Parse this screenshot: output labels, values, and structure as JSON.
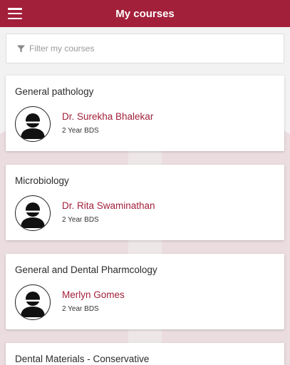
{
  "appbar": {
    "title": "My courses",
    "menu_icon": "hamburger-menu-icon",
    "color": "#a3203b"
  },
  "filter": {
    "placeholder": "Filter my courses",
    "value": "",
    "icon": "filter-icon"
  },
  "courses": [
    {
      "title": "General pathology",
      "teacher": "Dr. Surekha Bhalekar",
      "year": "2 Year BDS"
    },
    {
      "title": "Microbiology",
      "teacher": "Dr. Rita Swaminathan",
      "year": "2 Year BDS"
    },
    {
      "title": "General and Dental Pharmcology",
      "teacher": "Merlyn Gomes",
      "year": "2 Year BDS"
    },
    {
      "title": "Dental Materials - Conservative"
    }
  ],
  "colors": {
    "accent": "#a3203b",
    "background": "#f2f2f2",
    "card": "#ffffff"
  }
}
